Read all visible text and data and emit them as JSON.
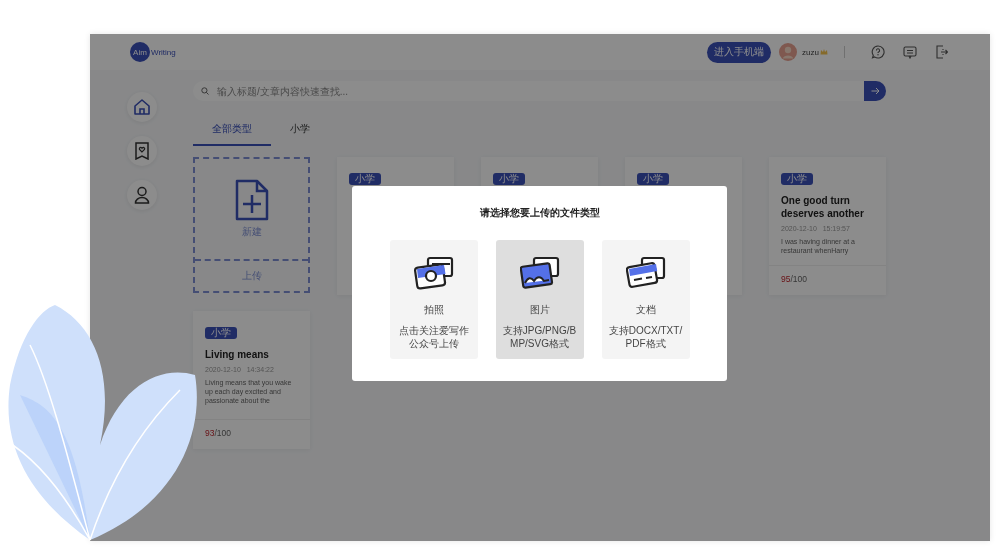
{
  "header": {
    "logo_mark": "Aim",
    "logo_text": "Writing",
    "mobile_button": "进入手机端",
    "username": "zuzu"
  },
  "search": {
    "placeholder": "输入标题/文章内容快速查找..."
  },
  "tabs": [
    {
      "label": "全部类型",
      "selected": true
    },
    {
      "label": "小学",
      "selected": false
    }
  ],
  "new_card": {
    "create": "新建",
    "upload": "上传"
  },
  "essays": [
    {
      "tag": "小学"
    },
    {
      "tag": "小学"
    },
    {
      "tag": "小学"
    },
    {
      "tag": "小学",
      "title": "One good turn deserves another",
      "date": "2020-12-10",
      "time": "15:19:57",
      "excerpt": "I was having dinner at a restaurant whenHarry",
      "score": "95",
      "total": "/100"
    },
    {
      "tag": "小学",
      "title": "Living means",
      "date": "2020-12-10",
      "time": "14:34:22",
      "excerpt": "Living means that you wake up each day excited and passionate about the",
      "score": "93",
      "total": "/100"
    }
  ],
  "modal": {
    "title": "请选择您要上传的文件类型",
    "options": [
      {
        "kind": "camera",
        "label": "拍照",
        "description": "点击关注爱写作公众号上传",
        "selected": false
      },
      {
        "kind": "image",
        "label": "图片",
        "description": "支持JPG/PNG/BMP/SVG格式",
        "selected": true
      },
      {
        "kind": "document",
        "label": "文档",
        "description": "支持DOCX/TXT/PDF格式",
        "selected": false
      }
    ]
  }
}
